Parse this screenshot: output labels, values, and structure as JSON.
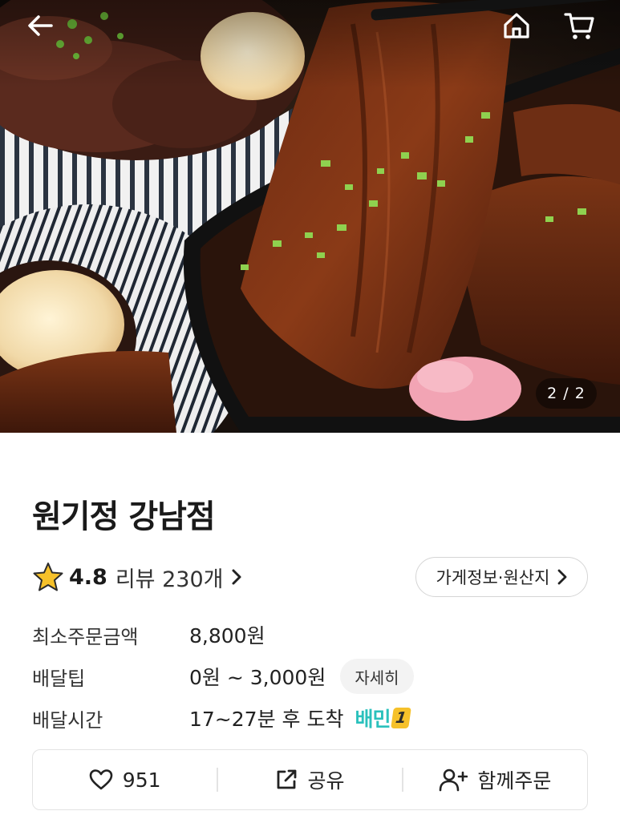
{
  "hero": {
    "counter": "2 / 2",
    "icons": {
      "back": "back-arrow-icon",
      "home": "home-icon",
      "cart": "cart-icon"
    }
  },
  "store": {
    "name": "원기정 강남점",
    "rating": "4.8",
    "review_label": "리뷰 230개",
    "info_button": "가게정보·원산지"
  },
  "info_rows": {
    "min_order": {
      "label": "최소주문금액",
      "value": "8,800원"
    },
    "delivery_tip": {
      "label": "배달팁",
      "value": "0원 ~ 3,000원",
      "detail": "자세히"
    },
    "delivery_time": {
      "label": "배달시간",
      "value": "17~27분 후 도착",
      "badge_text": "배민",
      "badge_number": "1"
    }
  },
  "actions": {
    "like_count": "951",
    "share_label": "공유",
    "group_order_label": "함께주문"
  },
  "colors": {
    "accent_mint": "#2ac1bc",
    "star": "#f6c12a",
    "text": "#222222",
    "border": "#e3e3e3"
  }
}
